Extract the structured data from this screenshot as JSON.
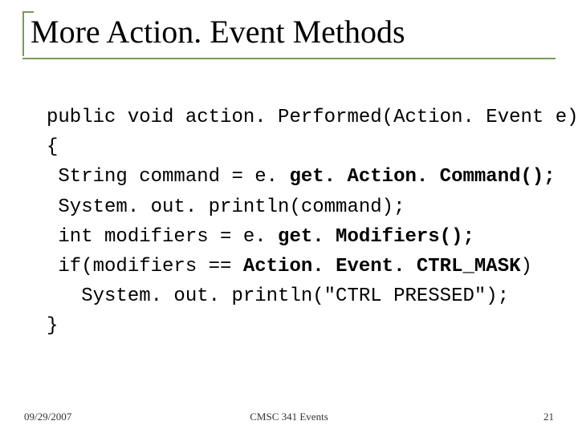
{
  "title": "More Action. Event Methods",
  "code": {
    "l1": "public void action. Performed(Action. Event e)",
    "l2": "{",
    "l3a": " String command = e. ",
    "l3b": "get. Action. Command();",
    "l4": " System. out. println(command);",
    "l5a": " int modifiers = e. ",
    "l5b": "get. Modifiers();",
    "l6a": " if(modifiers == ",
    "l6b": "Action. Event. CTRL_MASK",
    "l6c": ")",
    "l7": "   System. out. println(\"CTRL PRESSED\");",
    "l8": "}"
  },
  "footer": {
    "date": "09/29/2007",
    "center": "CMSC 341 Events",
    "page": "21"
  }
}
